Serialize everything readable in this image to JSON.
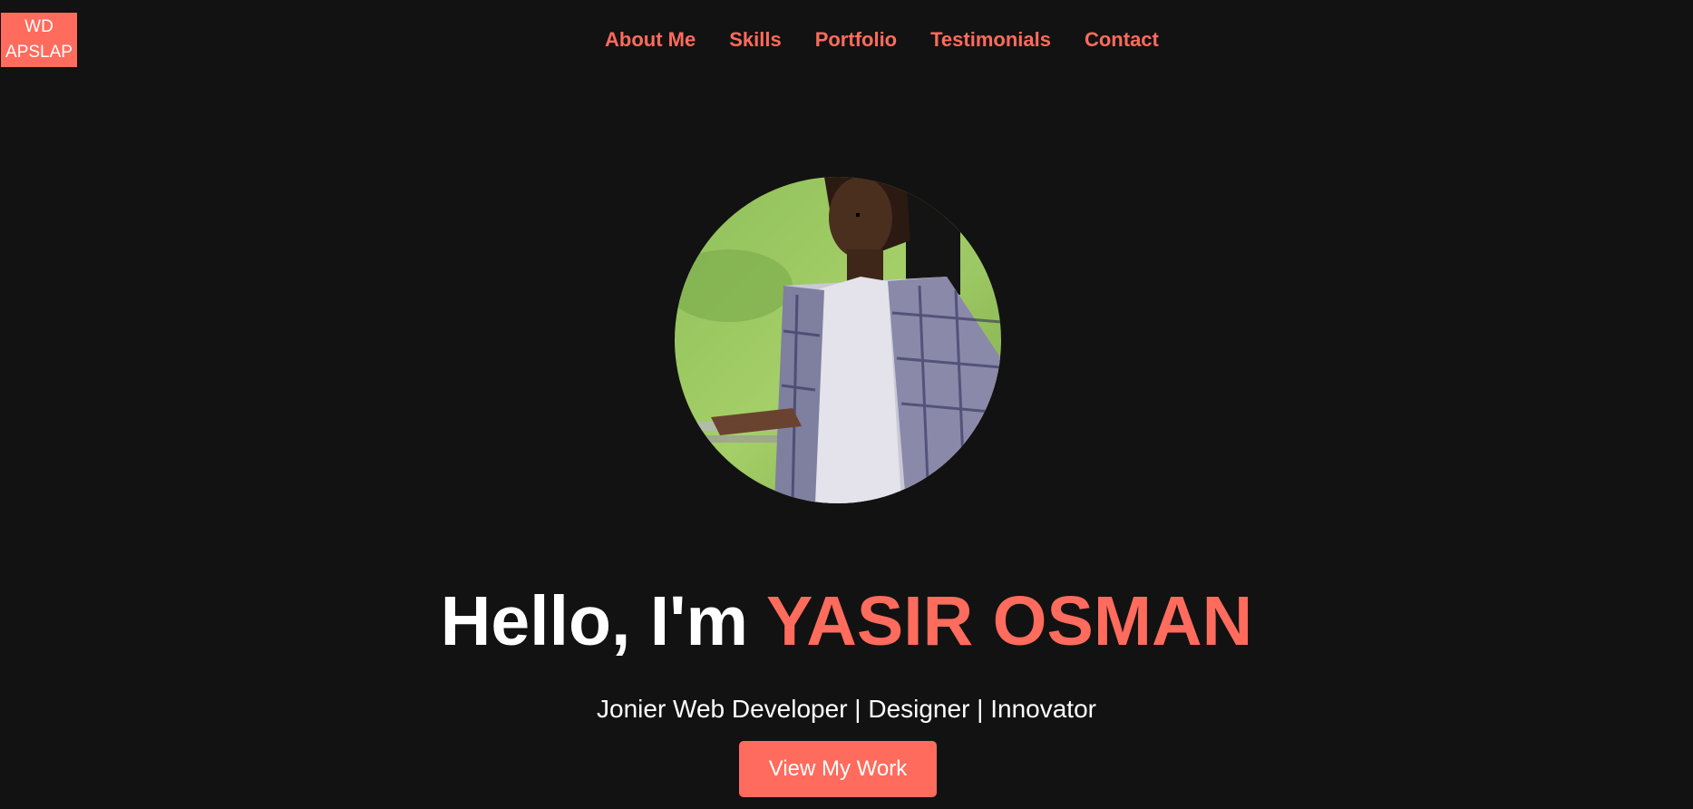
{
  "brand": {
    "logo_line1": "WD",
    "logo_line2": "APSLAP"
  },
  "nav": {
    "items": [
      {
        "label": "About Me"
      },
      {
        "label": "Skills"
      },
      {
        "label": "Portfolio"
      },
      {
        "label": "Testimonials"
      },
      {
        "label": "Contact"
      }
    ]
  },
  "hero": {
    "greeting": "Hello, I'm ",
    "name": "YASIR OSMAN",
    "subtitle": "Jonier Web Developer | Designer | Innovator",
    "cta_label": "View My Work"
  },
  "colors": {
    "accent": "#ff6b5c",
    "background": "#121212",
    "text": "#ffffff"
  }
}
